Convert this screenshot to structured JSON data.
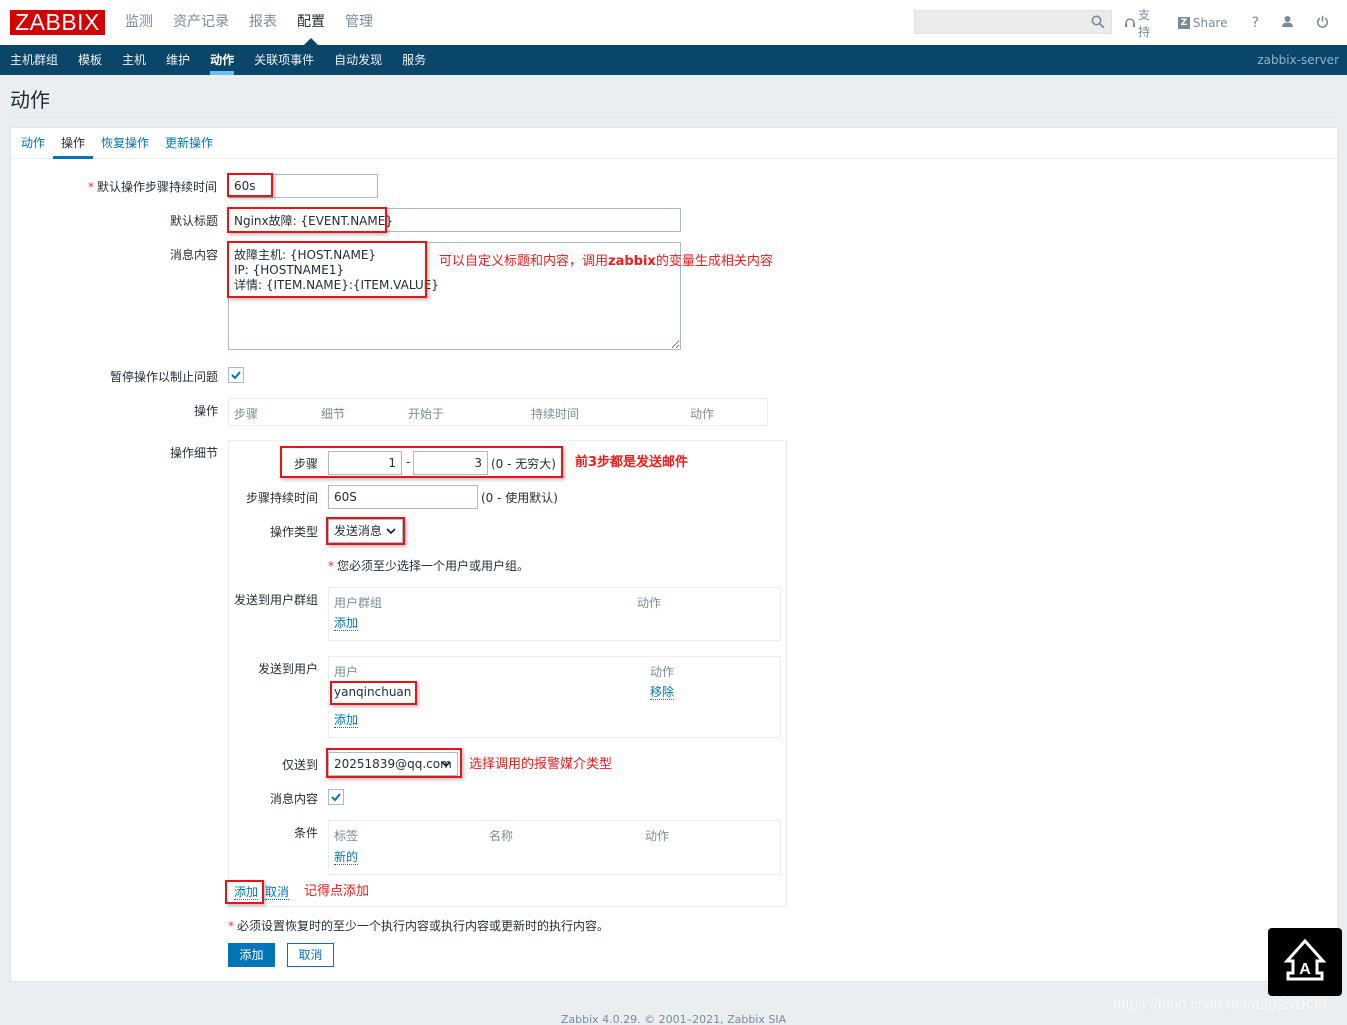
{
  "header": {
    "logo": "ZABBIX",
    "main_nav": [
      {
        "label": "监测",
        "active": false
      },
      {
        "label": "资产记录",
        "active": false
      },
      {
        "label": "报表",
        "active": false
      },
      {
        "label": "配置",
        "active": true
      },
      {
        "label": "管理",
        "active": false
      }
    ],
    "search": {
      "value": "",
      "placeholder": ""
    },
    "support_label": "支持",
    "share_label": "Share",
    "help_label": "?"
  },
  "sub_nav": {
    "items": [
      {
        "label": "主机群组",
        "active": false
      },
      {
        "label": "模板",
        "active": false
      },
      {
        "label": "主机",
        "active": false
      },
      {
        "label": "维护",
        "active": false
      },
      {
        "label": "动作",
        "active": true
      },
      {
        "label": "关联项事件",
        "active": false
      },
      {
        "label": "自动发现",
        "active": false
      },
      {
        "label": "服务",
        "active": false
      }
    ],
    "server_name": "zabbix-server"
  },
  "page": {
    "title": "动作",
    "tabs": [
      {
        "label": "动作",
        "active": false
      },
      {
        "label": "操作",
        "active": true
      },
      {
        "label": "恢复操作",
        "active": false
      },
      {
        "label": "更新操作",
        "active": false
      }
    ]
  },
  "form": {
    "default_step_duration": {
      "label": "默认操作步骤持续时间",
      "required_mark": "*",
      "value": "60s"
    },
    "default_subject": {
      "label": "默认标题",
      "value": "Nginx故障: {EVENT.NAME}"
    },
    "default_message": {
      "label": "消息内容",
      "value": "故障主机: {HOST.NAME}\nIP: {HOSTNAME1}\n详情: {ITEM.NAME}:{ITEM.VALUE}"
    },
    "pause_suppressed": {
      "label": "暂停操作以制止问题",
      "checked": true
    },
    "operations": {
      "label": "操作",
      "columns": [
        "步骤",
        "细节",
        "开始于",
        "持续时间",
        "动作"
      ]
    },
    "operation_details": {
      "label": "操作细节",
      "steps": {
        "label": "步骤",
        "from": "1",
        "separator": "-",
        "to": "3",
        "hint": "(0 - 无穷大)"
      },
      "step_duration": {
        "label": "步骤持续时间",
        "value": "60S",
        "hint": "(0 - 使用默认)"
      },
      "operation_type": {
        "label": "操作类型",
        "selected": "发送消息"
      },
      "must_select_note": {
        "required_mark": "*",
        "text": "您必须至少选择一个用户或用户组。"
      },
      "send_to_groups": {
        "label": "发送到用户群组",
        "columns": [
          "用户群组",
          "动作"
        ],
        "add_link": "添加"
      },
      "send_to_users": {
        "label": "发送到用户",
        "columns": [
          "用户",
          "动作"
        ],
        "rows": [
          {
            "user": "yanqinchuan",
            "action": "移除"
          }
        ],
        "add_link": "添加"
      },
      "send_only_to": {
        "label": "仅送到",
        "selected": "20251839@qq.com"
      },
      "default_message": {
        "label": "消息内容",
        "checked": true
      },
      "conditions": {
        "label": "条件",
        "columns": [
          "标签",
          "名称",
          "动作"
        ],
        "new_link": "新的"
      },
      "add_link": "添加",
      "cancel_link": "取消"
    },
    "recovery_note": {
      "required_mark": "*",
      "text": "必须设置恢复时的至少一个执行内容或执行内容或更新时的执行内容。"
    },
    "buttons": {
      "add": "添加",
      "cancel": "取消"
    }
  },
  "annotations": {
    "subject_content_note_prefix": "可以自定义标题和内容，调用",
    "subject_content_note_bold": "zabbix",
    "subject_content_note_suffix": "的变量生成相关内容",
    "steps_note": "前3步都是发送邮件",
    "media_note": "选择调用的报警媒介类型",
    "add_note": "记得点添加"
  },
  "footer": {
    "text": "Zabbix 4.0.29. © 2001–2021, Zabbix SIA"
  },
  "watermark": {
    "text": "https://blog.csdn.net/a20251839"
  }
}
